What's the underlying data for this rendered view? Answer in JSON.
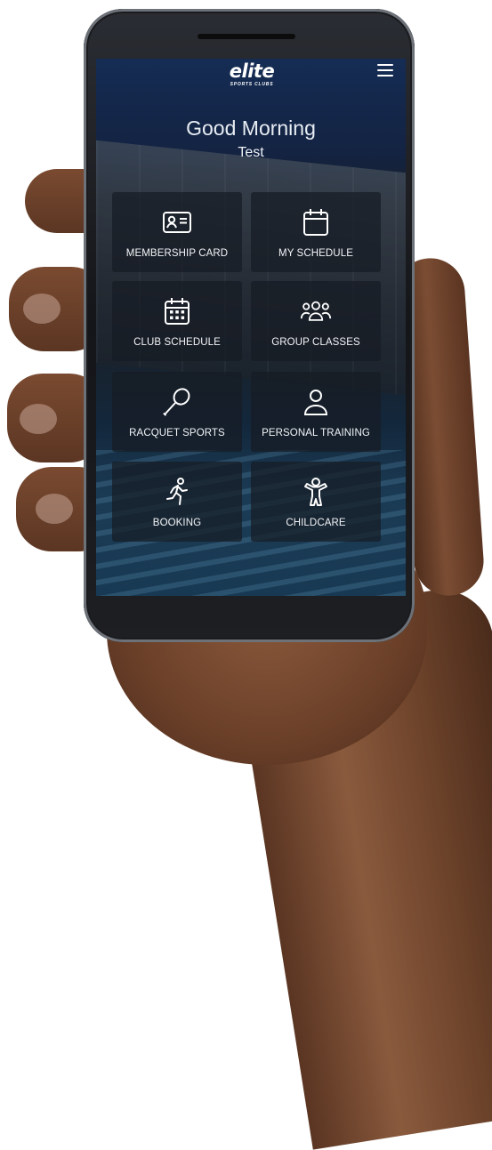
{
  "header": {
    "logo_text": "elite",
    "logo_subtext": "SPORTS CLUBS",
    "menu_icon": "hamburger-icon"
  },
  "greeting": {
    "salutation": "Good Morning",
    "user_name": "Test"
  },
  "tiles": [
    {
      "label": "MEMBERSHIP CARD",
      "icon": "id-card-icon"
    },
    {
      "label": "MY SCHEDULE",
      "icon": "calendar-icon"
    },
    {
      "label": "CLUB SCHEDULE",
      "icon": "calendar-grid-icon"
    },
    {
      "label": "GROUP CLASSES",
      "icon": "group-icon"
    },
    {
      "label": "RACQUET SPORTS",
      "icon": "racquet-icon"
    },
    {
      "label": "PERSONAL TRAINING",
      "icon": "person-icon"
    },
    {
      "label": "BOOKING",
      "icon": "running-person-icon"
    },
    {
      "label": "CHILDCARE",
      "icon": "child-icon"
    }
  ],
  "colors": {
    "tile_background": "#161c24",
    "text": "#ffffff"
  }
}
